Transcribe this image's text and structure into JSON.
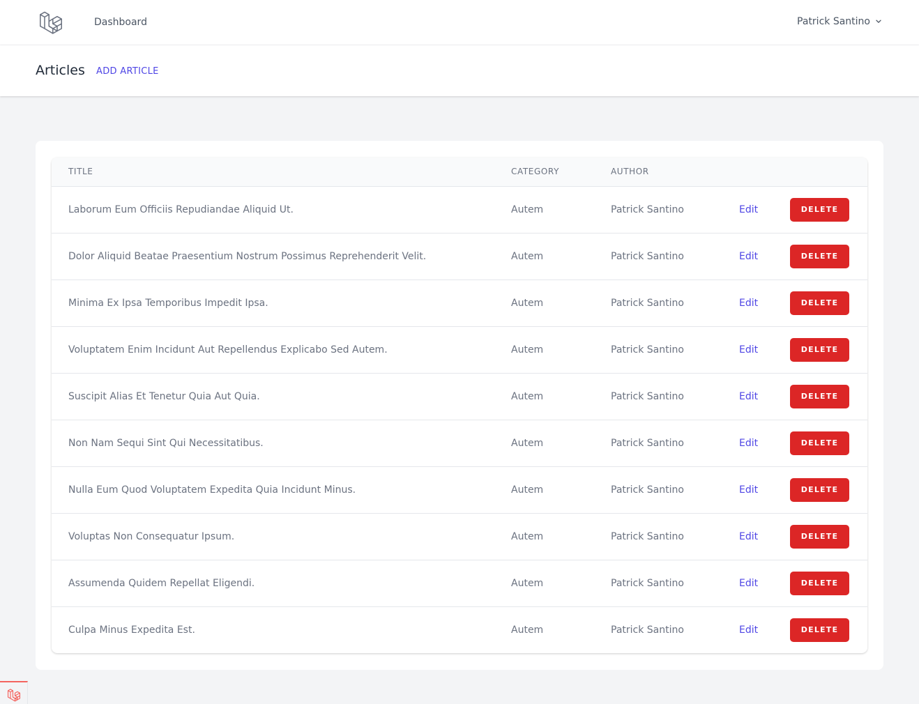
{
  "nav": {
    "logo_icon": "laravel-logo-icon",
    "dashboard_label": "Dashboard",
    "user_name": "Patrick Santino",
    "user_menu_icon": "chevron-down-icon"
  },
  "header": {
    "title": "Articles",
    "add_label": "ADD ARTICLE"
  },
  "table": {
    "columns": {
      "title": "TITLE",
      "category": "CATEGORY",
      "author": "AUTHOR"
    },
    "edit_label": "Edit",
    "delete_label": "DELETE",
    "rows": [
      {
        "title": "Laborum Eum Officiis Repudiandae Aliquid Ut.",
        "category": "Autem",
        "author": "Patrick Santino"
      },
      {
        "title": "Dolor Aliquid Beatae Praesentium Nostrum Possimus Reprehenderit Velit.",
        "category": "Autem",
        "author": "Patrick Santino"
      },
      {
        "title": "Minima Ex Ipsa Temporibus Impedit Ipsa.",
        "category": "Autem",
        "author": "Patrick Santino"
      },
      {
        "title": "Voluptatem Enim Incidunt Aut Repellendus Explicabo Sed Autem.",
        "category": "Autem",
        "author": "Patrick Santino"
      },
      {
        "title": "Suscipit Alias Et Tenetur Quia Aut Quia.",
        "category": "Autem",
        "author": "Patrick Santino"
      },
      {
        "title": "Non Nam Sequi Sint Qui Necessitatibus.",
        "category": "Autem",
        "author": "Patrick Santino"
      },
      {
        "title": "Nulla Eum Quod Voluptatem Expedita Quia Incidunt Minus.",
        "category": "Autem",
        "author": "Patrick Santino"
      },
      {
        "title": "Voluptas Non Consequatur Ipsum.",
        "category": "Autem",
        "author": "Patrick Santino"
      },
      {
        "title": "Assumenda Quidem Repellat Eligendi.",
        "category": "Autem",
        "author": "Patrick Santino"
      },
      {
        "title": "Culpa Minus Expedita Est.",
        "category": "Autem",
        "author": "Patrick Santino"
      }
    ]
  },
  "debugbar": {
    "icon": "laravel-debugbar-icon"
  },
  "colors": {
    "accent": "#4f46e5",
    "danger": "#dc2626",
    "page_bg": "#f3f4f6"
  }
}
